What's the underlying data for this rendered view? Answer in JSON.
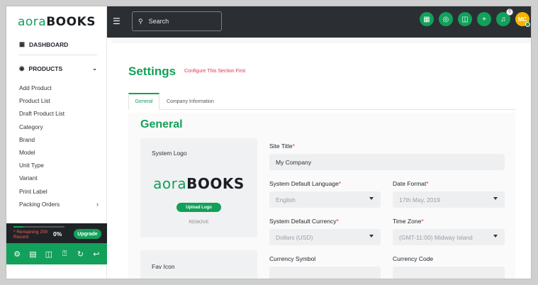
{
  "brand": {
    "logo_part1": "aora",
    "logo_part2": "BOOKS"
  },
  "sidebar": {
    "dashboard": "DASHBOARD",
    "products": "PRODUCTS",
    "items": [
      {
        "label": "Add Product"
      },
      {
        "label": "Product List"
      },
      {
        "label": "Draft Product List"
      },
      {
        "label": "Category"
      },
      {
        "label": "Brand"
      },
      {
        "label": "Model"
      },
      {
        "label": "Unit Type"
      },
      {
        "label": "Variant"
      },
      {
        "label": "Print Label"
      },
      {
        "label": "Packing Orders"
      }
    ],
    "remaining_text": "* Remaining 200 Record",
    "remaining_percent": "0%",
    "remaining_fraction": 0.2,
    "upgrade_label": "Upgrade",
    "footer_icons": [
      "settings-icon",
      "chart-icon",
      "book-icon",
      "help-icon",
      "refresh-icon",
      "logout-icon"
    ]
  },
  "topbar": {
    "search_placeholder": "Search",
    "notification_count": "0",
    "avatar_initials": "MC"
  },
  "page": {
    "title": "Settings",
    "note": "Configure This Section First",
    "tabs": [
      {
        "label": "General"
      },
      {
        "label": "Company Information"
      }
    ],
    "section_title": "General",
    "system_logo_label": "System Logo",
    "upload_logo_label": "Upload Logo",
    "remove_label": "REMOVE",
    "fav_icon_label": "Fav Icon",
    "fields": {
      "site_title": {
        "label": "Site Title",
        "value": "My Company"
      },
      "default_language": {
        "label": "System Default Language",
        "value": "English"
      },
      "date_format": {
        "label": "Date Format",
        "value": "17th May, 2019"
      },
      "default_currency": {
        "label": "System Default Currency",
        "value": "Dollars (USD)"
      },
      "time_zone": {
        "label": "Time Zone",
        "value": "(GMT-11:00) Midway Island"
      },
      "currency_symbol": {
        "label": "Currency Symbol"
      },
      "currency_code": {
        "label": "Currency Code"
      }
    }
  },
  "colors": {
    "accent": "#12a05a",
    "danger": "#e0334c",
    "topbar": "#2b2f33"
  }
}
